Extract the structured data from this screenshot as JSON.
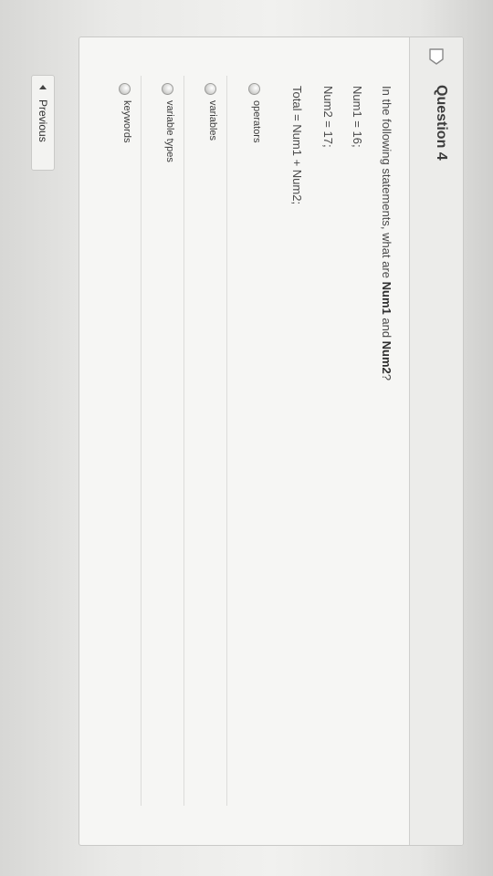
{
  "question": {
    "title": "Question 4",
    "prompt_start": "In the following statements, what are ",
    "prompt_bold1": "Num1",
    "prompt_mid": " and ",
    "prompt_bold2": "Num2",
    "prompt_end": "?",
    "code_line1": "Num1 = 16;",
    "code_line2": "Num2 = 17;",
    "code_line3": "Total = Num1 + Num2;"
  },
  "answers": [
    {
      "label": "operators"
    },
    {
      "label": "variables"
    },
    {
      "label": "variable types"
    },
    {
      "label": "keywords"
    }
  ],
  "navigation": {
    "previous_label": "Previous"
  },
  "icons": {
    "bookmark": "bookmark-icon",
    "previous_arrow": "chevron-left-icon"
  },
  "colors": {
    "bookmark_outline": "#8a8a8a",
    "card_border": "#c9c9c7"
  }
}
